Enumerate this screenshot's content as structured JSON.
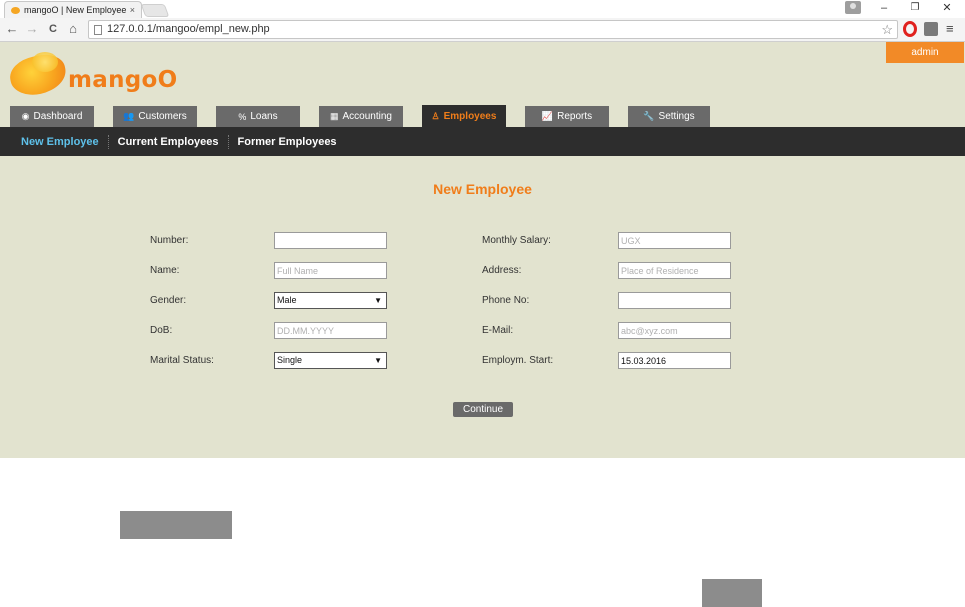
{
  "browser": {
    "tab_title": "mangoO | New Employee",
    "tab_close": "×",
    "url": "127.0.0.1/mangoo/empl_new.php",
    "nav_back": "←",
    "nav_forward": "→",
    "nav_reload": "C",
    "nav_home": "⌂",
    "star": "☆",
    "menu": "≡",
    "win_min": "–",
    "win_restore": "❐",
    "win_close": "✕"
  },
  "header": {
    "logo_text": "mangoO",
    "user_label": "admin"
  },
  "tabs": [
    {
      "label": "Dashboard",
      "icon": "◉"
    },
    {
      "label": "Customers",
      "icon": "👥"
    },
    {
      "label": "Loans",
      "icon": "%"
    },
    {
      "label": "Accounting",
      "icon": "▦"
    },
    {
      "label": "Employees",
      "icon": "♙"
    },
    {
      "label": "Reports",
      "icon": "📈"
    },
    {
      "label": "Settings",
      "icon": "🔧"
    }
  ],
  "subnav": [
    "New Employee",
    "Current Employees",
    "Former Employees"
  ],
  "form": {
    "title": "New Employee",
    "left": [
      {
        "label": "Number:",
        "value": "",
        "placeholder": ""
      },
      {
        "label": "Name:",
        "value": "",
        "placeholder": "Full Name"
      },
      {
        "label": "Gender:",
        "value": "Male"
      },
      {
        "label": "DoB:",
        "value": "",
        "placeholder": "DD.MM.YYYY"
      },
      {
        "label": "Marital Status:",
        "value": "Single"
      }
    ],
    "right": [
      {
        "label": "Monthly Salary:",
        "value": "",
        "placeholder": "UGX"
      },
      {
        "label": "Address:",
        "value": "",
        "placeholder": "Place of Residence"
      },
      {
        "label": "Phone No:",
        "value": "",
        "placeholder": ""
      },
      {
        "label": "E-Mail:",
        "value": "",
        "placeholder": "abc@xyz.com"
      },
      {
        "label": "Employm. Start:",
        "value": "15.03.2016",
        "placeholder": ""
      }
    ],
    "select_arrow": "▼",
    "submit_label": "Continue"
  },
  "colors": {
    "accent": "#f07d1a",
    "page_bg": "#e2e3cf",
    "nav_dark": "#2d2d2d",
    "tab_gray": "#6a6a6a",
    "active_sub": "#5ec1ea"
  }
}
